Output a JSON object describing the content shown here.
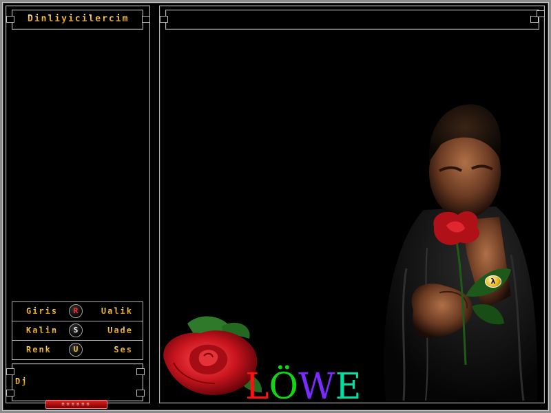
{
  "header": {
    "title": "Dinliyicilercim"
  },
  "menu": [
    {
      "left": "Giris",
      "key": "R",
      "right": "Ualik",
      "key_color": "red"
    },
    {
      "left": "Kalin",
      "key": "S",
      "right": "Uade",
      "key_color": "white"
    },
    {
      "left": "Renk",
      "key": "U",
      "right": "Ses",
      "key_color": "yellow"
    }
  ],
  "dj": {
    "label": "Dj"
  },
  "status_tab": {
    "label": "≡≡≡≡≡≡"
  },
  "logo": {
    "letters": [
      {
        "char": "L",
        "color": "#ff1111"
      },
      {
        "char": "Ö",
        "color": "#12d612"
      },
      {
        "char": "W",
        "color": "#7a2cff"
      },
      {
        "char": "E",
        "color": "#00e0a0"
      }
    ]
  },
  "badge": {
    "symbol": "λ"
  },
  "colors": {
    "frame": "#b5b5b5",
    "accent_gold": "#f6c43a",
    "rose_red": "#c8141e",
    "background": "#000000"
  }
}
